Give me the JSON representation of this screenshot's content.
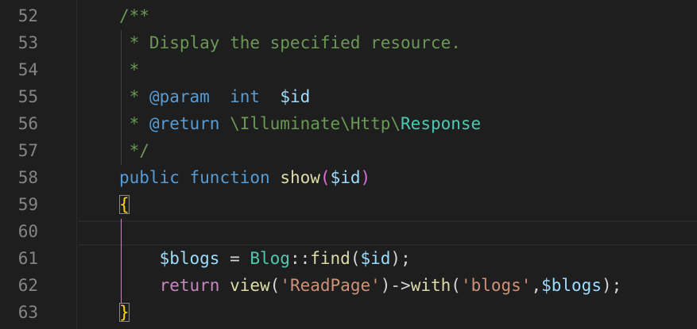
{
  "editor": {
    "lines": [
      {
        "number": "52",
        "tokens": [
          {
            "t": "/**",
            "c": "cm"
          }
        ]
      },
      {
        "number": "53",
        "tokens": [
          {
            "t": " * Display the specified resource.",
            "c": "cm"
          }
        ]
      },
      {
        "number": "54",
        "tokens": [
          {
            "t": " *",
            "c": "cm"
          }
        ]
      },
      {
        "number": "55",
        "tokens": [
          {
            "t": " * ",
            "c": "cm"
          },
          {
            "t": "@param",
            "c": "doc"
          },
          {
            "t": "  ",
            "c": "cm"
          },
          {
            "t": "int",
            "c": "doc"
          },
          {
            "t": "  ",
            "c": "cm"
          },
          {
            "t": "$id",
            "c": "var"
          }
        ]
      },
      {
        "number": "56",
        "tokens": [
          {
            "t": " * ",
            "c": "cm"
          },
          {
            "t": "@return",
            "c": "doc"
          },
          {
            "t": " \\Illuminate\\Http\\",
            "c": "cm"
          },
          {
            "t": "Response",
            "c": "cls"
          }
        ]
      },
      {
        "number": "57",
        "tokens": [
          {
            "t": " */",
            "c": "cm"
          }
        ]
      },
      {
        "number": "58",
        "tokens": [
          {
            "t": "public",
            "c": "kw"
          },
          {
            "t": " ",
            "c": "pn"
          },
          {
            "t": "function",
            "c": "kw"
          },
          {
            "t": " ",
            "c": "pn"
          },
          {
            "t": "show",
            "c": "fn"
          },
          {
            "t": "(",
            "c": "brk1"
          },
          {
            "t": "$id",
            "c": "var"
          },
          {
            "t": ")",
            "c": "brk1"
          }
        ]
      },
      {
        "number": "59",
        "tokens": [
          {
            "t": "{",
            "c": "brk2 match"
          }
        ]
      },
      {
        "number": "60",
        "tokens": []
      },
      {
        "number": "61",
        "tokens": [
          {
            "t": "    ",
            "c": "pn"
          },
          {
            "t": "$blogs",
            "c": "var"
          },
          {
            "t": " = ",
            "c": "pn"
          },
          {
            "t": "Blog",
            "c": "cls"
          },
          {
            "t": "::",
            "c": "pn"
          },
          {
            "t": "find",
            "c": "fn"
          },
          {
            "t": "(",
            "c": "pn"
          },
          {
            "t": "$id",
            "c": "var"
          },
          {
            "t": ");",
            "c": "pn"
          }
        ]
      },
      {
        "number": "62",
        "tokens": [
          {
            "t": "    ",
            "c": "pn"
          },
          {
            "t": "return",
            "c": "ret"
          },
          {
            "t": " ",
            "c": "pn"
          },
          {
            "t": "view",
            "c": "fn"
          },
          {
            "t": "(",
            "c": "pn"
          },
          {
            "t": "'ReadPage'",
            "c": "str"
          },
          {
            "t": ")->",
            "c": "pn"
          },
          {
            "t": "with",
            "c": "fn"
          },
          {
            "t": "(",
            "c": "pn"
          },
          {
            "t": "'blogs'",
            "c": "str"
          },
          {
            "t": ",",
            "c": "pn"
          },
          {
            "t": "$blogs",
            "c": "var"
          },
          {
            "t": ");",
            "c": "pn"
          }
        ]
      },
      {
        "number": "63",
        "tokens": [
          {
            "t": "}",
            "c": "brk2 match"
          }
        ]
      }
    ]
  },
  "colors": {
    "background": "#1e1e1e",
    "line_number": "#858585",
    "comment": "#6a9955",
    "keyword": "#569cd6",
    "function": "#dcdcaa",
    "variable": "#9cdcfe",
    "class": "#4ec9b0",
    "string": "#ce9178",
    "control": "#c586c0",
    "bracket_match": "#ffd700"
  }
}
